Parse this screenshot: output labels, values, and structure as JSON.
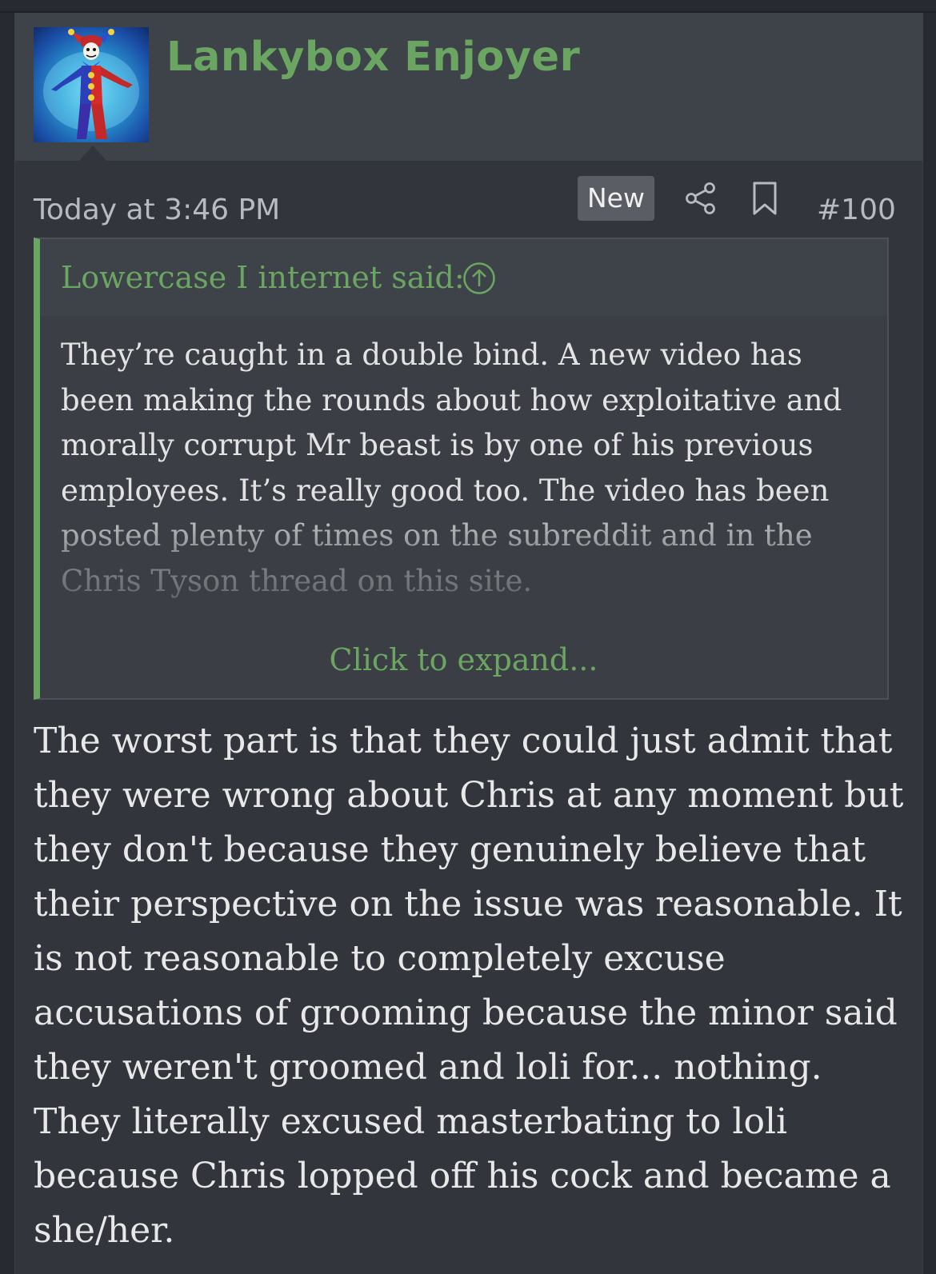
{
  "post": {
    "username": "Lankybox Enjoyer",
    "avatar_icon": "jester-avatar",
    "timestamp": "Today at 3:46 PM",
    "new_badge": "New",
    "share_icon": "share-icon",
    "bookmark_icon": "bookmark-icon",
    "post_number": "#100"
  },
  "quote": {
    "attribution": "Lowercase I internet said:",
    "body": "They’re caught in a double bind. A new video has\nbeen making the rounds about how exploitative and\nmorally corrupt Mr beast is by one of his previous\nemployees. It’s really good too. The video has been\nposted plenty of times on the subreddit and in the\nChris Tyson thread on this site.",
    "expand_label": "Click to expand..."
  },
  "body": "The worst part is that they could just admit that\nthey were wrong about Chris at any moment but\nthey don't because they genuinely believe that\ntheir perspective on the issue was reasonable. It\nis not reasonable to completely excuse\naccusations of grooming because the minor said\nthey weren't groomed and loli for... nothing.\nThey literally excused masterbating to loli\nbecause Chris lopped off his cock and became a\nshe/her.",
  "colors": {
    "accent_green": "#6ba562",
    "background": "#272a30",
    "post_background": "#32353c",
    "header_background": "#3e4249",
    "text": "#e8e8e8",
    "muted_text": "#b7babf"
  }
}
